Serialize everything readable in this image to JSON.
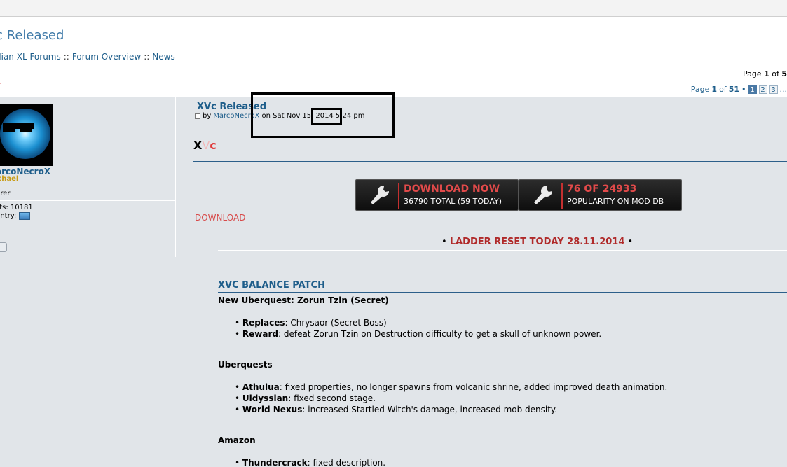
{
  "page": {
    "title": "c Released",
    "breadcrumb": [
      "dian XL Forums",
      "Forum Overview",
      "News"
    ],
    "breadcrumb_sep": "::",
    "pageinfo_top": {
      "label": "Page",
      "current": "1",
      "of": "of",
      "total": "5"
    },
    "arrow_glyph": "»"
  },
  "pagination": {
    "label": "Page",
    "current": "1",
    "of": "of",
    "total": "51",
    "dot": "•",
    "pages": [
      "1",
      "2",
      "3"
    ],
    "more": "..."
  },
  "author": {
    "username": "arcoNecroX",
    "rank": "lthael",
    "rank_title": "hrer",
    "posts_label": "sts:",
    "posts": "10181",
    "country_label": "untry:"
  },
  "post": {
    "title": "XVc Released",
    "by": "by",
    "author_link": "MarcoNecroX",
    "date_prefix": "on Sat Nov 15,",
    "year": "2014",
    "time": "5:24 pm",
    "logo": {
      "x": "X",
      "v": "V",
      "c": "c"
    },
    "download_link": "DOWNLOAD",
    "badges": [
      {
        "line1": "DOWNLOAD NOW",
        "line2": "36790 TOTAL (59 TODAY)"
      },
      {
        "line1": "76 OF 24933",
        "line2": "POPULARITY ON MOD DB"
      }
    ],
    "ladder": {
      "bullet": "•",
      "text": "LADDER RESET TODAY 28.11.2014"
    },
    "section_title": "XVC BALANCE PATCH",
    "sections": [
      {
        "heading": "New Uberquest: Zorun Tzin (Secret)",
        "items": [
          {
            "key": "Replaces",
            "text": ": Chrysaor (Secret Boss)"
          },
          {
            "key": "Reward",
            "text": ": defeat Zorun Tzin on Destruction difficulty to get a skull of unknown power."
          }
        ]
      },
      {
        "heading": "Uberquests",
        "items": [
          {
            "key": "Athulua",
            "text": ": fixed properties, no longer spawns from volcanic shrine, added improved death animation."
          },
          {
            "key": "Uldyssian",
            "text": ": fixed second stage."
          },
          {
            "key": "World Nexus",
            "text": ": increased Startled Witch's damage, increased mob density."
          }
        ]
      },
      {
        "heading": "Amazon",
        "items": [
          {
            "key": "Thundercrack",
            "text": ": fixed description."
          }
        ]
      }
    ]
  },
  "colors": {
    "link": "#1d5d8a",
    "accent_red": "#d74a4a",
    "rank_gold": "#c89b15",
    "content_bg": "#e1e5e9"
  },
  "icons": [
    "wrench-icon",
    "post-icon",
    "flag-icon",
    "profile-icon",
    "avatar-image"
  ]
}
